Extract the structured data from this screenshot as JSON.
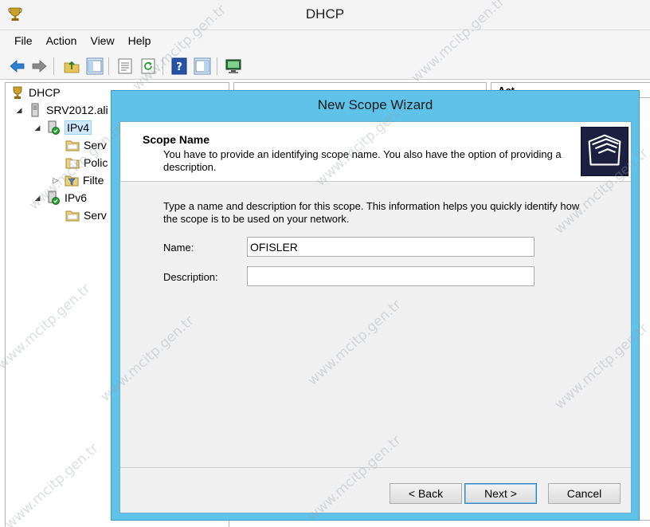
{
  "window": {
    "title": "DHCP",
    "icon": "dhcp-trophy-icon"
  },
  "menu": [
    "File",
    "Action",
    "View",
    "Help"
  ],
  "toolbar": {
    "icons": [
      "back-arrow-icon",
      "forward-arrow-icon",
      "up-folder-icon",
      "show-hide-tree-icon",
      "properties-icon",
      "refresh-icon",
      "help-icon",
      "action-pane-icon",
      "monitor-icon"
    ]
  },
  "tree": {
    "root": "DHCP",
    "server": "SRV2012.ali",
    "ipv4": "IPv4",
    "ipv4_children": [
      "Serv",
      "Polic",
      "Filte"
    ],
    "ipv6": "IPv6",
    "ipv6_children": [
      "Serv"
    ]
  },
  "right_header": "Act",
  "wizard": {
    "title": "New Scope Wizard",
    "header_title": "Scope Name",
    "header_subtitle": "You have to provide an identifying scope name. You also have the option of providing a description.",
    "intro": "Type a name and description for this scope. This information helps you quickly identify how the scope is to be used on your network.",
    "name_label": "Name:",
    "name_value": "OFISLER",
    "description_label": "Description:",
    "description_value": "",
    "back_label": "< Back",
    "next_label": "Next >",
    "cancel_label": "Cancel"
  },
  "watermark": "www.mcitp.gen.tr",
  "colors": {
    "wizard_frame": "#5fc2e8",
    "selection": "#cde8ff"
  }
}
